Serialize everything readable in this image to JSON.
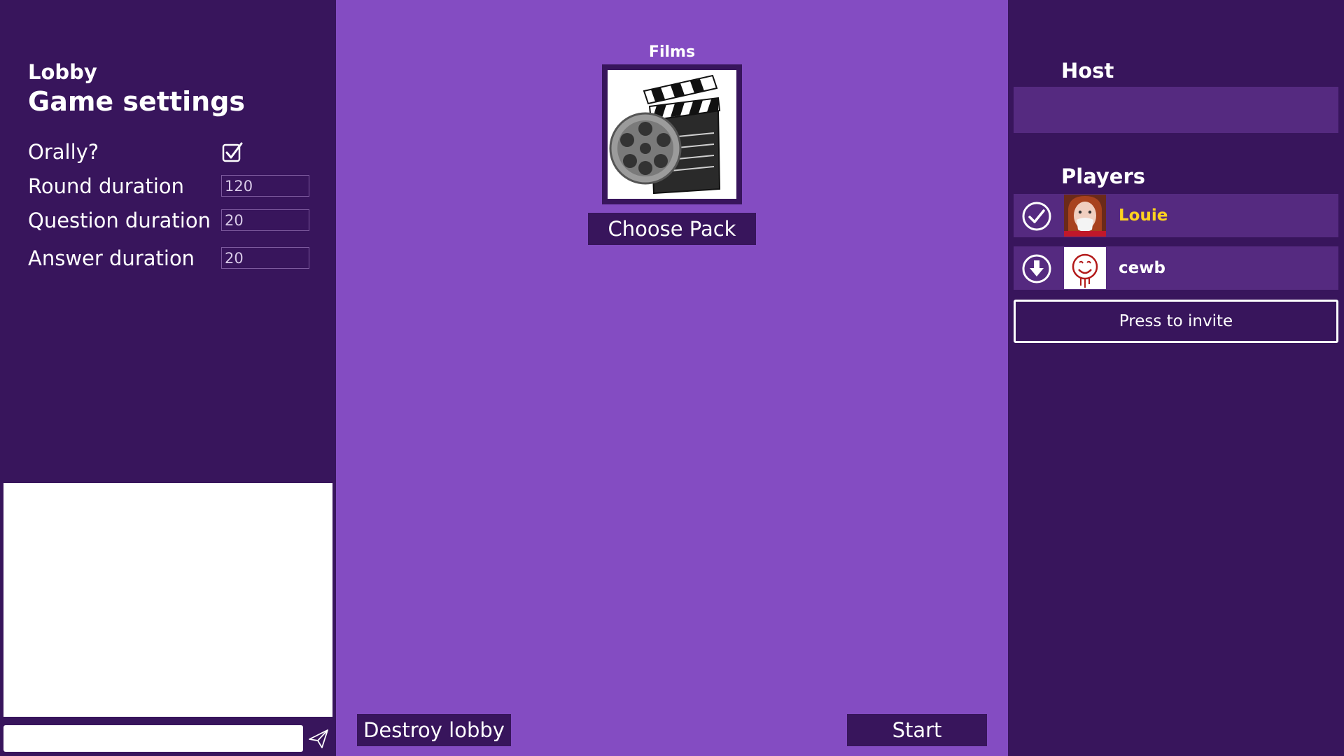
{
  "left": {
    "lobby_label": "Lobby",
    "settings_title": "Game settings",
    "settings": {
      "orally": {
        "label": "Orally?",
        "checked": true
      },
      "round_duration": {
        "label": "Round duration",
        "value": "120"
      },
      "question_duration": {
        "label": "Question duration",
        "value": "20"
      },
      "answer_duration": {
        "label": "Answer duration",
        "value": "20"
      }
    },
    "chat": {
      "input_value": ""
    }
  },
  "center": {
    "pack_name": "Films",
    "choose_pack_label": "Choose Pack",
    "destroy_label": "Destroy lobby",
    "start_label": "Start"
  },
  "right": {
    "host_title": "Host",
    "players_title": "Players",
    "players": [
      {
        "name": "Louie",
        "status": "ready",
        "status_icon": "check-circle-icon",
        "name_color": "#ffd21f"
      },
      {
        "name": "cewb",
        "status": "downloading",
        "status_icon": "download-circle-icon",
        "name_color": "#ffffff"
      }
    ],
    "invite_label": "Press to invite"
  },
  "colors": {
    "panel_dark": "#38155c",
    "panel_center": "#844cc2",
    "row": "#552a80",
    "highlight_name": "#ffd21f"
  }
}
